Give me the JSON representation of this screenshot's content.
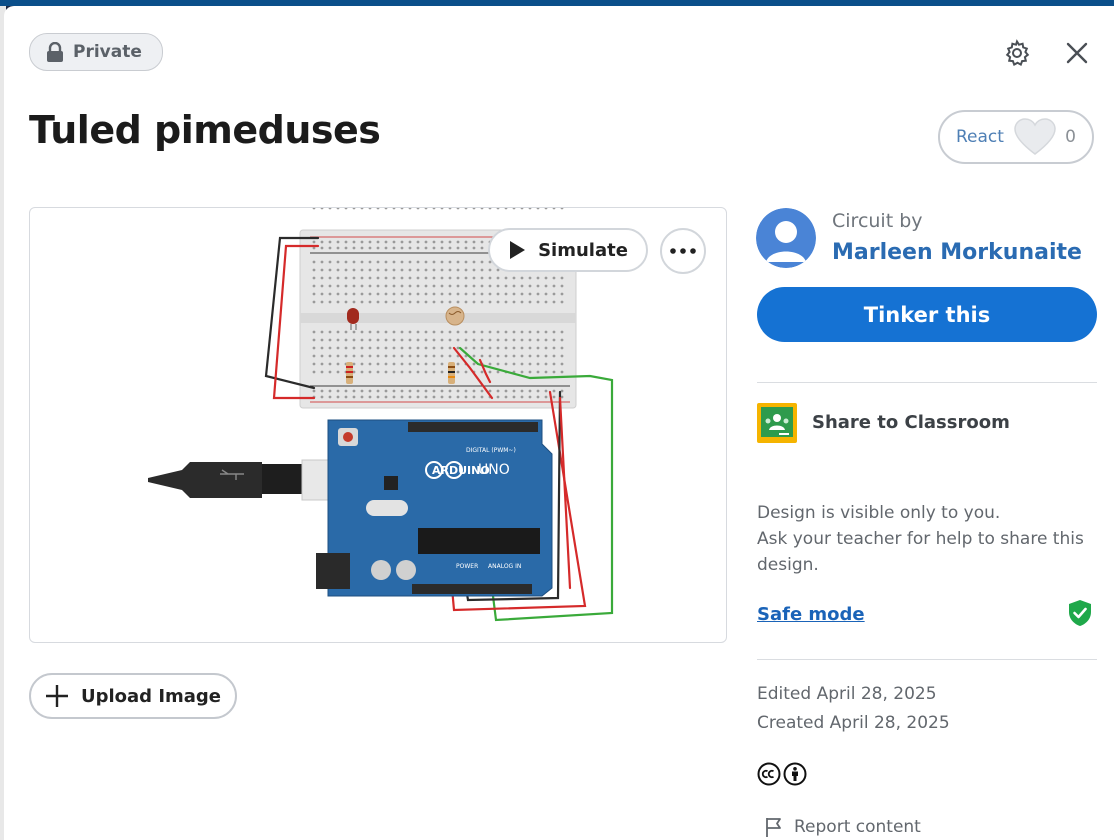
{
  "badge": {
    "label": "Private",
    "icon": "lock-icon"
  },
  "header": {
    "settings_icon": "gear-icon",
    "close_icon": "close-icon"
  },
  "design": {
    "title": "Tuled pimeduses"
  },
  "reactions": {
    "label": "React",
    "count": "0",
    "icon": "heart-icon"
  },
  "preview": {
    "simulate_label": "Simulate",
    "more_icon": "more-horizontal-icon",
    "board_logo_text": "UNO",
    "board_brand": "ARDUINO",
    "digital_header": "DIGITAL (PWM~)",
    "analog_header": "ANALOG IN",
    "power_header": "POWER"
  },
  "upload": {
    "label": "Upload Image",
    "icon": "plus-icon"
  },
  "author": {
    "prefix": "Circuit by",
    "name": "Marleen Morkunaite",
    "avatar_icon": "avatar-icon"
  },
  "actions": {
    "tinker_label": "Tinker this"
  },
  "classroom": {
    "label": "Share to Classroom",
    "icon": "google-classroom-icon"
  },
  "visibility": {
    "line1": "Design is visible only to you.",
    "line2": "Ask your teacher for help to share this design."
  },
  "safe_mode": {
    "label": "Safe mode",
    "icon": "shield-check-icon"
  },
  "dates": {
    "edited": "Edited April 28, 2025",
    "created": "Created April 28, 2025"
  },
  "license": {
    "icons": [
      "creative-commons-icon",
      "attribution-icon"
    ]
  },
  "report": {
    "label": "Report content",
    "icon": "flag-icon"
  },
  "colors": {
    "primary": "#1572d3",
    "link": "#2a6bb2",
    "safe_green": "#1fa84a",
    "board_blue": "#2a6aa8"
  }
}
